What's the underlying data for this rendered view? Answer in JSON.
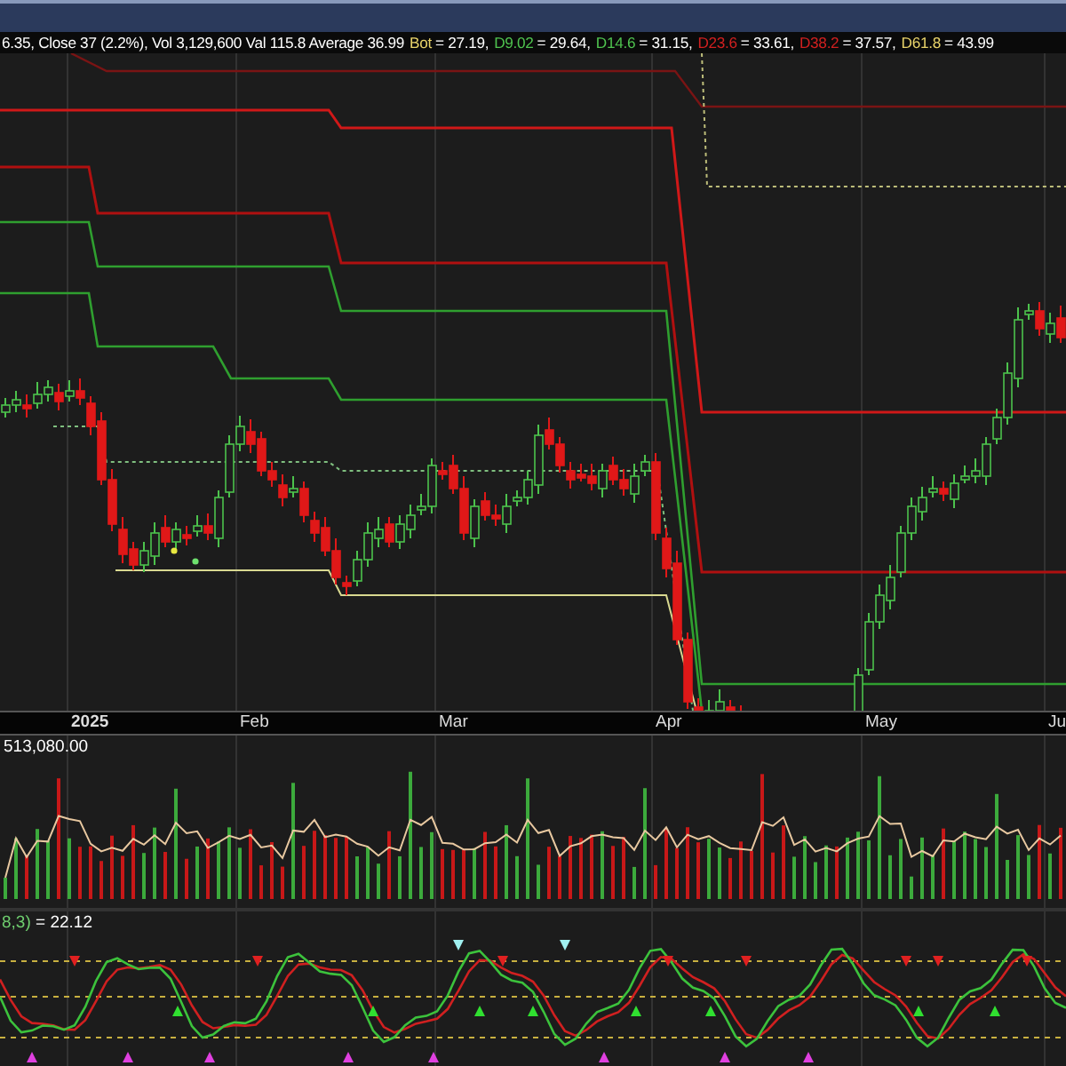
{
  "quote_line": {
    "text": "6.35, Close 37 (2.2%), Vol 3,129,600 Val 115.8 Average 36.99",
    "indicators": [
      {
        "label": "Bot",
        "value": "= 27.19,",
        "color": "#e8d36a"
      },
      {
        "label": "D9.02",
        "value": "= 29.64,",
        "color": "#4fc34f"
      },
      {
        "label": "D14.6",
        "value": "= 31.15,",
        "color": "#4fc34f"
      },
      {
        "label": "D23.6",
        "value": "= 33.61,",
        "color": "#d02020"
      },
      {
        "label": "D38.2",
        "value": "= 37.57,",
        "color": "#d02020"
      },
      {
        "label": "D61.8",
        "value": "= 43.99",
        "color": "#e8d36a"
      }
    ]
  },
  "x_axis": {
    "labels": [
      {
        "text": "2025",
        "kind": "year"
      },
      {
        "text": "Feb",
        "kind": "month"
      },
      {
        "text": "Mar",
        "kind": "month"
      },
      {
        "text": "Apr",
        "kind": "month"
      },
      {
        "text": "May",
        "kind": "month"
      },
      {
        "text": "Ju",
        "kind": "month"
      }
    ]
  },
  "volume_panel": {
    "label": "513,080.00"
  },
  "oscillator_panel": {
    "label": "8,3)",
    "value": "= 22.12"
  }
}
